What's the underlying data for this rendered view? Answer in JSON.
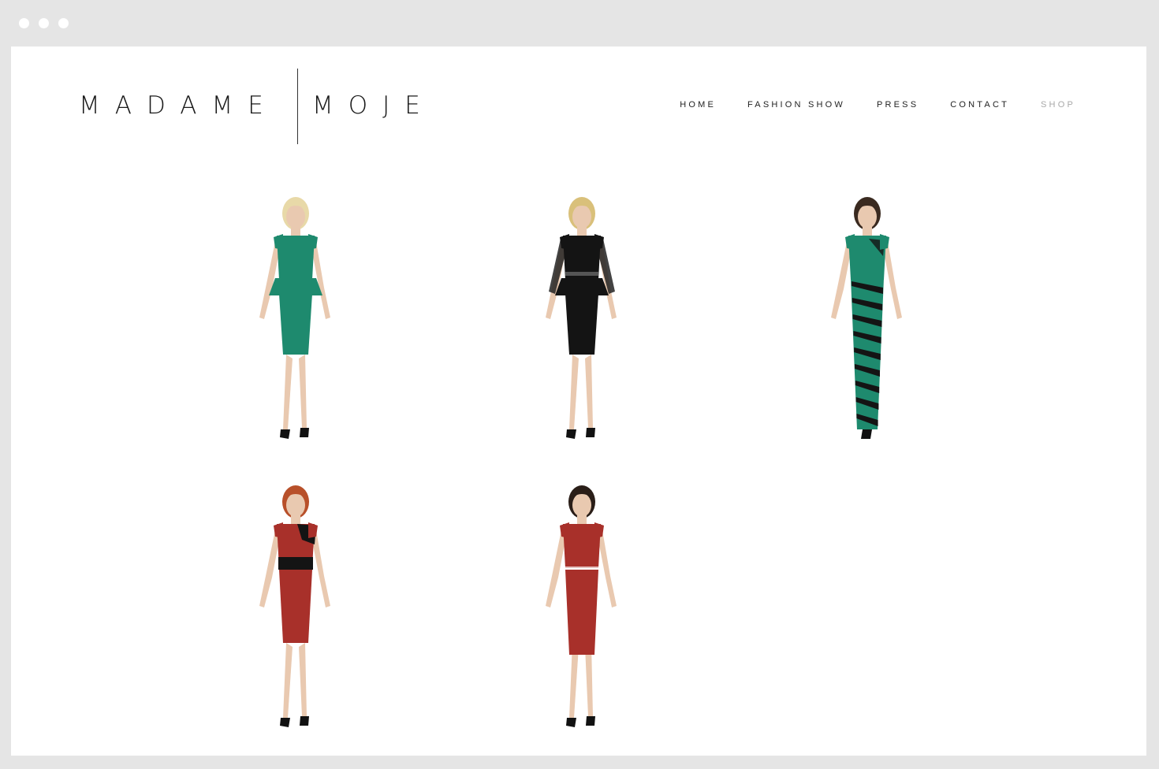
{
  "browser": {
    "window_dots": 3
  },
  "logo": {
    "left_word": "MADAME",
    "right_word": "MOJE"
  },
  "nav": {
    "items": [
      {
        "label": "HOME",
        "active": false
      },
      {
        "label": "FASHION SHOW",
        "active": false
      },
      {
        "label": "PRESS",
        "active": false
      },
      {
        "label": "CONTACT",
        "active": false
      },
      {
        "label": "SHOP",
        "active": true
      }
    ]
  },
  "gallery": {
    "items": [
      {
        "dress_color": "#1e8a6e",
        "accent_color": "#1e8a6e",
        "hair_color": "#e8d9a8",
        "style": "peplum"
      },
      {
        "dress_color": "#141414",
        "accent_color": "#2a2a2a",
        "hair_color": "#d9c07a",
        "style": "peplum-lace"
      },
      {
        "dress_color": "#1e8a6e",
        "accent_color": "#141414",
        "hair_color": "#3a2a20",
        "style": "gown-striped"
      },
      {
        "dress_color": "#a8302a",
        "accent_color": "#141414",
        "hair_color": "#b8502a",
        "style": "pencil-belt"
      },
      {
        "dress_color": "#a8302a",
        "accent_color": "#a8302a",
        "hair_color": "#2a1e18",
        "style": "two-piece"
      }
    ]
  }
}
